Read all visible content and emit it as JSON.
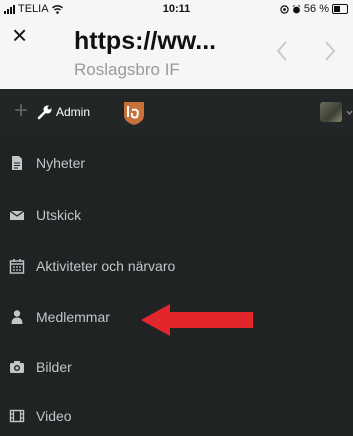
{
  "status_bar": {
    "carrier": "TELIA",
    "time": "10:11",
    "battery": "56 %"
  },
  "browser": {
    "close_symbol": "×",
    "url": "https://ww...",
    "site_title": "Roslagsbro IF"
  },
  "app_bar": {
    "add_symbol": "+",
    "admin_label": "Admin"
  },
  "menu": {
    "items": [
      {
        "label": "Nyheter",
        "icon": "document-icon"
      },
      {
        "label": "Utskick",
        "icon": "envelope-icon"
      },
      {
        "label": "Aktiviteter och närvaro",
        "icon": "calendar-icon"
      },
      {
        "label": "Medlemmar",
        "icon": "person-icon"
      },
      {
        "label": "Bilder",
        "icon": "camera-icon"
      },
      {
        "label": "Video",
        "icon": "film-icon"
      }
    ]
  },
  "colors": {
    "menu_background": "#1f2324",
    "menu_text": "#c3c6c7",
    "annotation_arrow": "#e3262b",
    "logo": "#c6703a"
  }
}
